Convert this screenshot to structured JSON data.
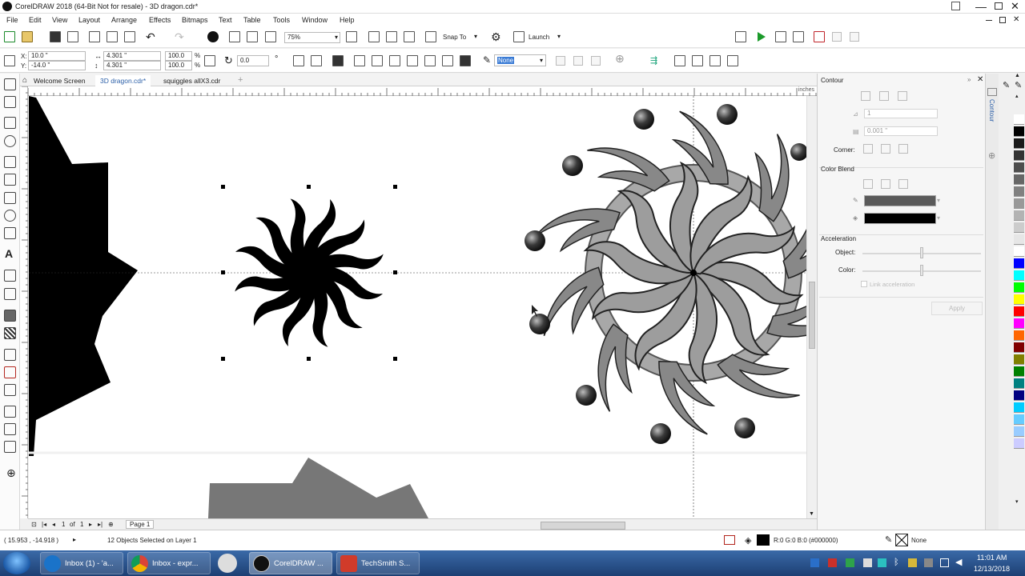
{
  "titlebar": {
    "title": "CorelDRAW 2018 (64-Bit Not for resale) - 3D dragon.cdr*"
  },
  "menu": [
    "File",
    "Edit",
    "View",
    "Layout",
    "Arrange",
    "Effects",
    "Bitmaps",
    "Text",
    "Table",
    "Tools",
    "Window",
    "Help"
  ],
  "toolbar": {
    "zoom": "75%",
    "snap_to": "Snap To",
    "launch": "Launch"
  },
  "propbar": {
    "x": "10.0 \"",
    "y": "-14.0 \"",
    "w": "4.301 \"",
    "h": "4.301 \"",
    "sx": "100.0",
    "sy": "100.0",
    "pct": "%",
    "rot": "0.0",
    "outline": "None",
    "x_lbl": "X:",
    "y_lbl": "Y:"
  },
  "tabs": [
    "Welcome Screen",
    "3D dragon.cdr*",
    "squiggles allX3.cdr"
  ],
  "ruler_units": "inches",
  "pagenav": {
    "current": "1",
    "of": "of",
    "total": "1",
    "page_label": "Page 1"
  },
  "docker": {
    "title": "Contour",
    "steps": "1",
    "offset": "0.001 \"",
    "corner": "Corner:",
    "color_blend": "Color Blend",
    "acceleration": "Acceleration",
    "object": "Object:",
    "color": "Color:",
    "link": "Link acceleration",
    "apply": "Apply",
    "tab_label": "Contour",
    "outline_color": "#5a5a5a",
    "fill_color": "#000000"
  },
  "palette_colors": [
    "#ffffff",
    "#000000",
    "#1a1a1a",
    "#333333",
    "#4d4d4d",
    "#666666",
    "#808080",
    "#999999",
    "#b3b3b3",
    "#cccccc",
    "#e6e6e6",
    "#ffffff",
    "#0000ff",
    "#00ffff",
    "#00ff00",
    "#ffff00",
    "#ff0000",
    "#ff00ff",
    "#ff6600",
    "#800000",
    "#808000",
    "#008000",
    "#008080",
    "#000080",
    "#00ccff",
    "#66ccff",
    "#99ccff",
    "#ccccff"
  ],
  "status": {
    "coords": "( 15.953 , -14.918 )",
    "selection": "12 Objects Selected on Layer 1",
    "fill_info": "R:0 G:0 B:0 (#000000)",
    "outline_info": "None"
  },
  "taskbar": {
    "items": [
      "Inbox (1) - 'a...",
      "Inbox - expr...",
      "CorelDRAW ...",
      "TechSmith S..."
    ],
    "time": "11:01 AM",
    "date": "12/13/2018"
  }
}
